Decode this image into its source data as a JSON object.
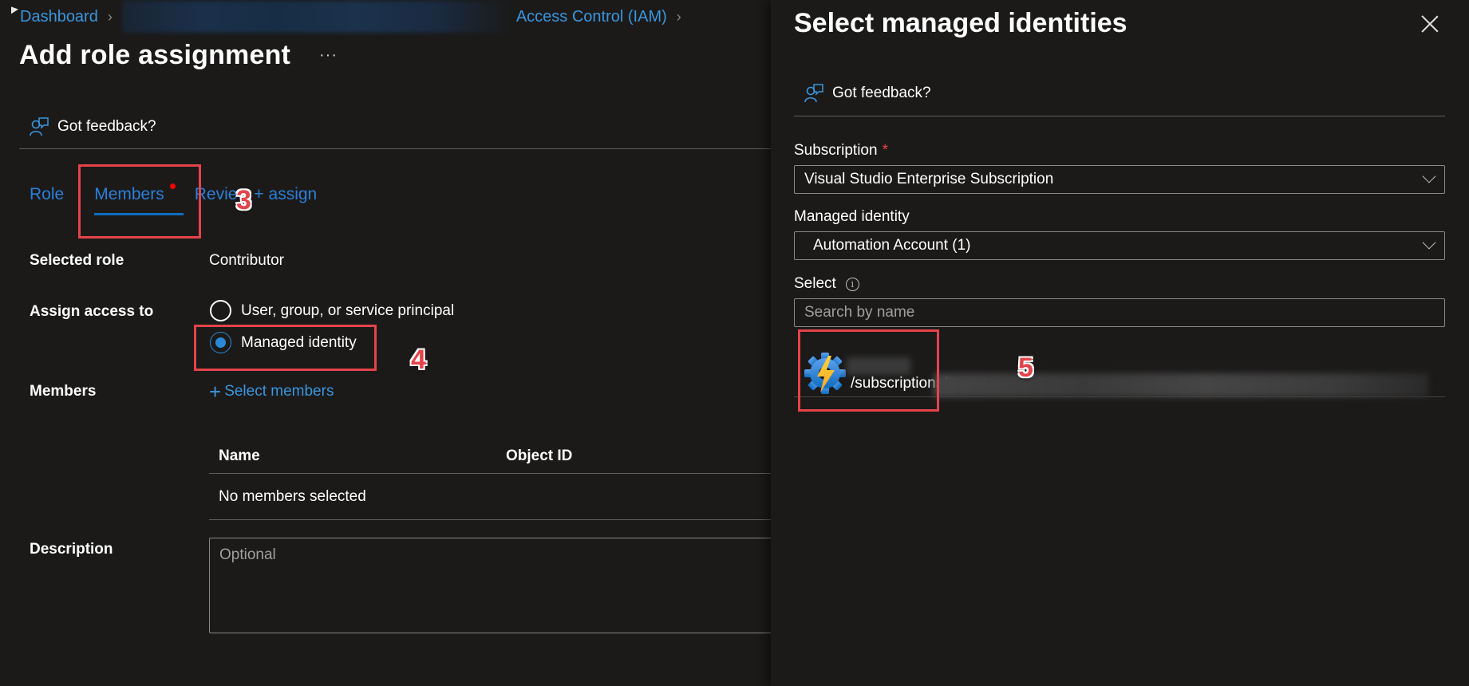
{
  "breadcrumb": {
    "items": [
      {
        "label": "Dashboard"
      },
      {
        "label": "Access Control (IAM)"
      }
    ]
  },
  "page": {
    "title": "Add role assignment",
    "more_label": "···",
    "feedback_label": "Got feedback?"
  },
  "tabs": [
    {
      "label": "Role",
      "active": false
    },
    {
      "label": "Members",
      "active": true
    },
    {
      "label": "Review + assign",
      "active": false
    }
  ],
  "form": {
    "selected_role_label": "Selected role",
    "selected_role_value": "Contributor",
    "assign_access_label": "Assign access to",
    "assign_options": [
      {
        "label": "User, group, or service principal",
        "checked": false
      },
      {
        "label": "Managed identity",
        "checked": true
      }
    ],
    "members_label": "Members",
    "select_members_label": "Select members",
    "members_table": {
      "columns": [
        "Name",
        "Object ID"
      ],
      "empty_message": "No members selected"
    },
    "description_label": "Description",
    "description_placeholder": "Optional"
  },
  "panel": {
    "title": "Select managed identities",
    "feedback_label": "Got feedback?",
    "subscription_label": "Subscription",
    "subscription_required": "*",
    "subscription_value": "Visual Studio Enterprise Subscription",
    "managed_identity_label": "Managed identity",
    "managed_identity_value": "Automation Account (1)",
    "select_label": "Select",
    "search_placeholder": "Search by name",
    "results": [
      {
        "type": "automation-account",
        "path_prefix": "/subscriptions/"
      }
    ]
  },
  "annotations": [
    "3",
    "4",
    "5"
  ],
  "colors": {
    "background": "#1b1a19",
    "link": "#3a96dd",
    "tab_active_underline": "#0f6cbd",
    "annotation_red": "#e4434a",
    "radio_checked": "#2b88d8"
  }
}
